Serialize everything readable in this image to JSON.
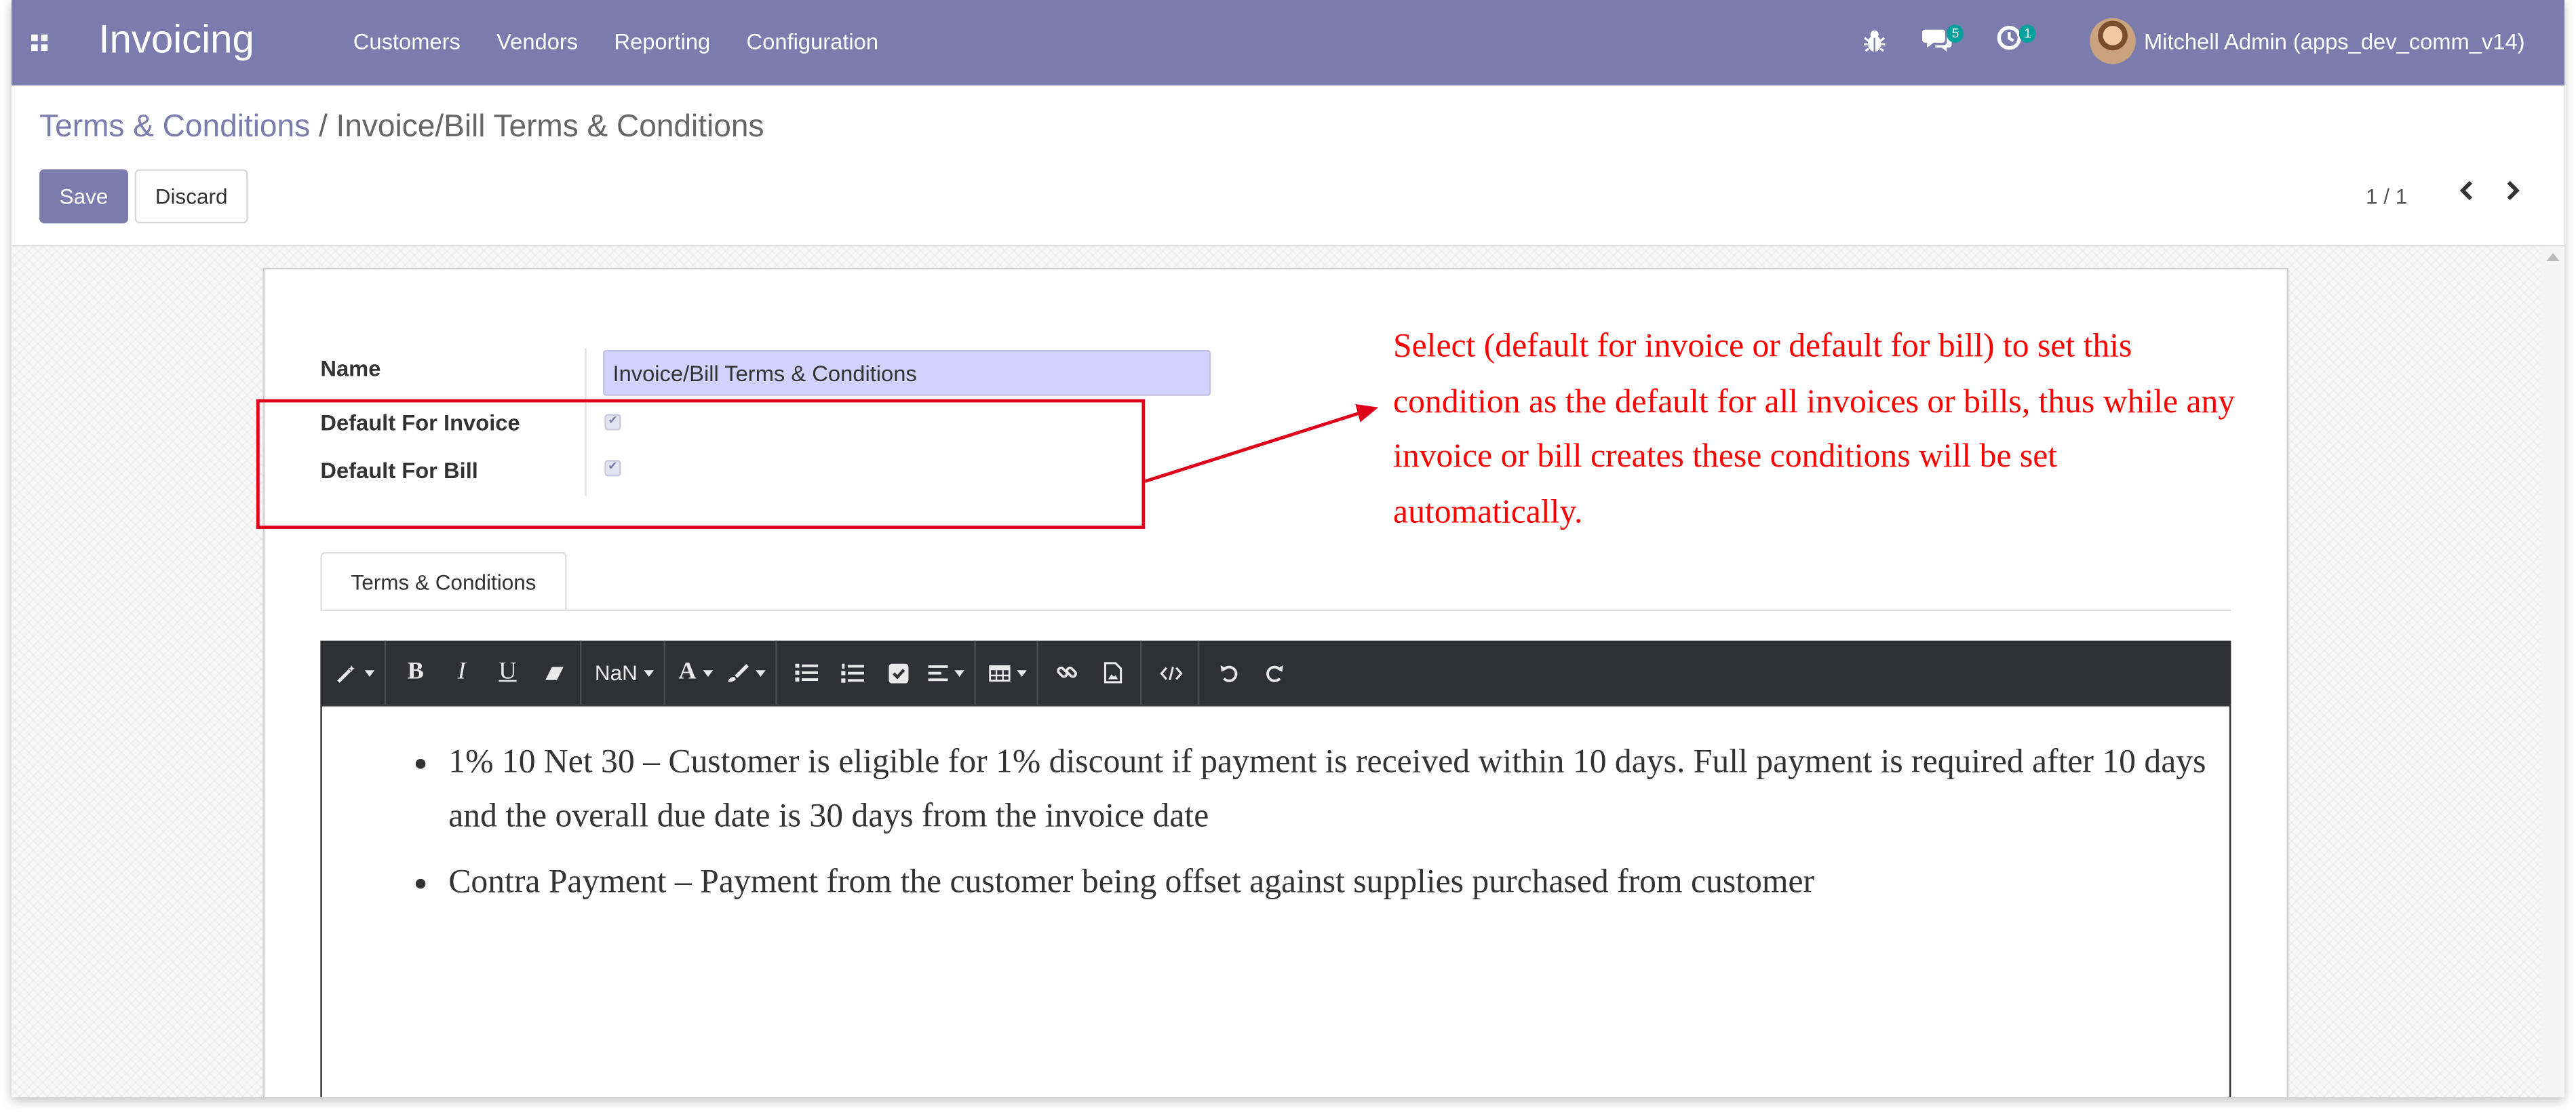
{
  "app": {
    "title": "Invoicing"
  },
  "menu": {
    "items": [
      "Customers",
      "Vendors",
      "Reporting",
      "Configuration"
    ]
  },
  "systray": {
    "messages_count": "5",
    "activities_count": "1",
    "user_name": "Mitchell Admin (apps_dev_comm_v14)"
  },
  "breadcrumb": {
    "parent": "Terms & Conditions",
    "separator": "/",
    "current": "Invoice/Bill Terms & Conditions"
  },
  "buttons": {
    "save": "Save",
    "discard": "Discard"
  },
  "pager": {
    "value": "1 / 1"
  },
  "form": {
    "name_label": "Name",
    "name_value": "Invoice/Bill Terms & Conditions",
    "default_invoice_label": "Default For Invoice",
    "default_invoice_checked": true,
    "default_bill_label": "Default For Bill",
    "default_bill_checked": true
  },
  "annotation": {
    "text": "Select (default for invoice or default for bill) to set this condition as the default for all invoices or bills, thus while any invoice or bill creates these conditions will be set automatically.",
    "color": "#ff0000"
  },
  "tabs": [
    {
      "label": "Terms & Conditions"
    }
  ],
  "toolbar": {
    "bold": "B",
    "italic": "I",
    "underline": "U",
    "font_size": "NaN",
    "font_color": "A"
  },
  "editor": {
    "items": [
      "1% 10 Net 30 – Customer is eligible for 1% discount if payment is received within 10 days. Full payment is required after 10 days and the overall due date is 30 days from the invoice date",
      "Contra Payment – Payment from the customer being offset against supplies purchased from customer"
    ]
  },
  "colors": {
    "brand": "#7c7bad",
    "badge": "#00a09d",
    "toolbar": "#2f3033"
  }
}
